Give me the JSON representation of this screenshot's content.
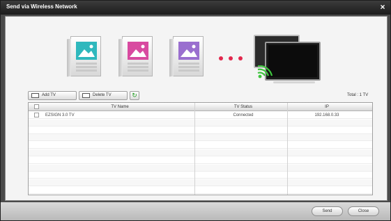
{
  "window": {
    "title": "Send via Wireless Network",
    "close_label": "×"
  },
  "toolbar": {
    "add_tv_label": "Add TV",
    "delete_tv_label": "Delete TV",
    "refresh_icon": "↻",
    "total_text": "Total : 1 TV"
  },
  "table": {
    "headers": {
      "name": "TV Name",
      "status": "TV Status",
      "ip": "IP"
    },
    "rows": [
      {
        "name": "EZSIGN 3.0 TV",
        "status": "Connected",
        "ip": "192.168.0.33"
      }
    ]
  },
  "footer": {
    "send_label": "Send",
    "close_label": "Close"
  },
  "colors": {
    "frame1": "#2fb8bd",
    "frame2": "#d84aa0",
    "frame3": "#9a6fcf",
    "dots": "#e2284d",
    "wifi": "#3ec43e"
  },
  "icons": [
    "close-icon",
    "add-tv-icon",
    "delete-tv-icon",
    "refresh-icon",
    "wifi-icon",
    "picture-icon"
  ]
}
